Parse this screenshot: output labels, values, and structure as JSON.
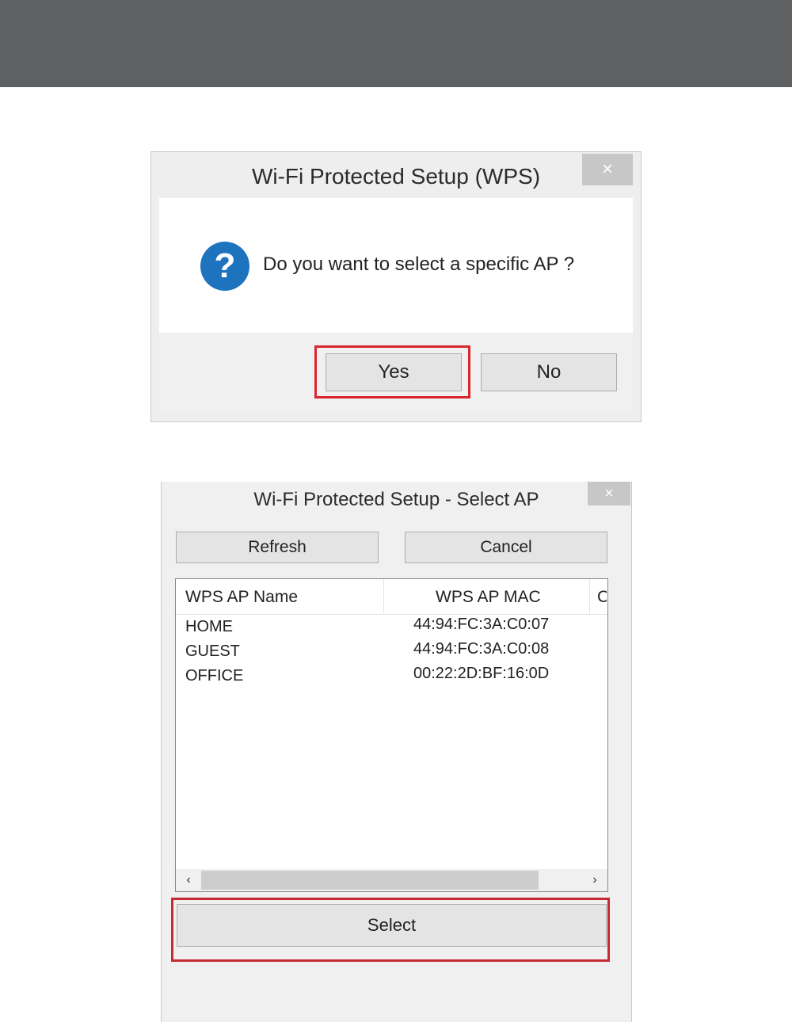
{
  "dialog1": {
    "title": "Wi-Fi Protected Setup (WPS)",
    "close_icon": "×",
    "question_icon": "?",
    "message": "Do you want to select a specific AP ?",
    "yes_label": "Yes",
    "no_label": "No"
  },
  "dialog2": {
    "title": "Wi-Fi Protected Setup - Select AP",
    "close_icon": "×",
    "refresh_label": "Refresh",
    "cancel_label": "Cancel",
    "columns": [
      "WPS AP Name",
      "WPS AP MAC",
      "C"
    ],
    "rows": [
      {
        "name": "HOME",
        "mac": "44:94:FC:3A:C0:07"
      },
      {
        "name": "GUEST",
        "mac": "44:94:FC:3A:C0:08"
      },
      {
        "name": "OFFICE",
        "mac": "00:22:2D:BF:16:0D"
      }
    ],
    "scroll_left": "‹",
    "scroll_right": "›",
    "select_label": "Select"
  },
  "colors": {
    "header_band": "#5f6062",
    "highlight": "#d8262e",
    "question_icon": "#1e73be"
  }
}
